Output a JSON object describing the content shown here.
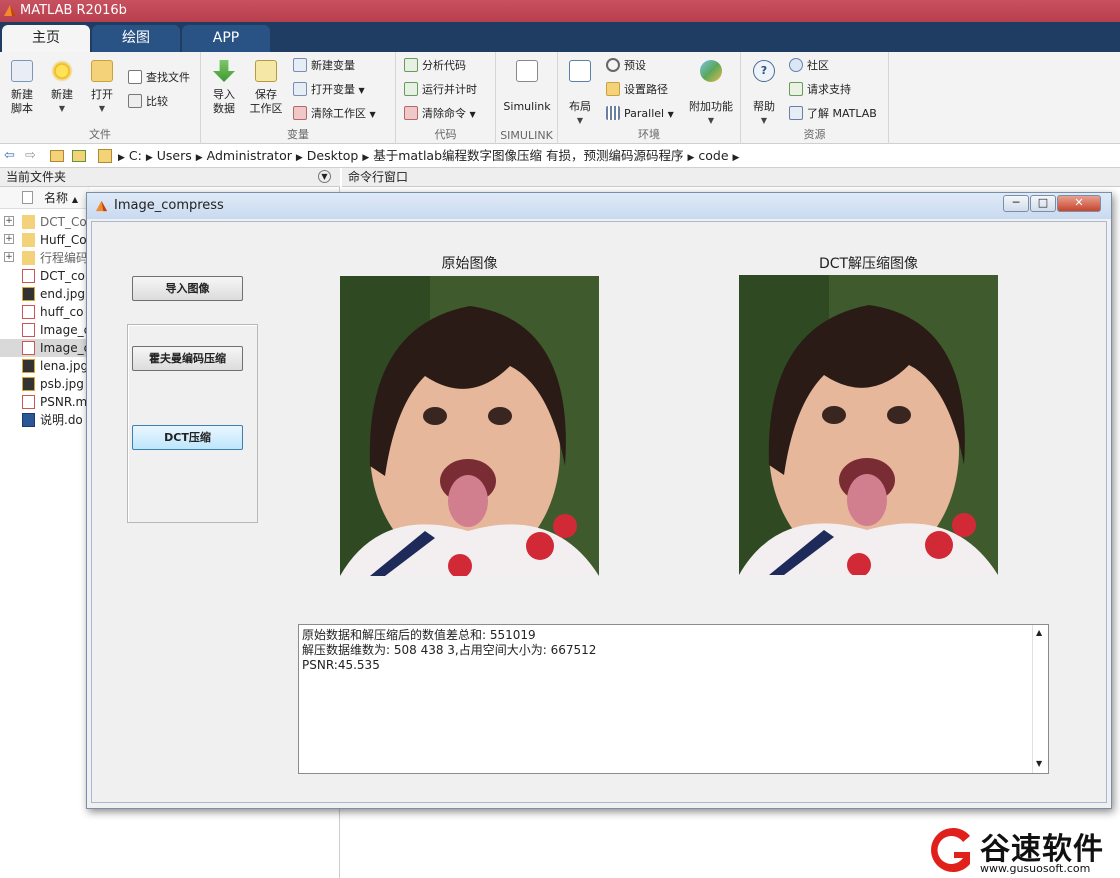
{
  "app": {
    "title": "MATLAB R2016b"
  },
  "tabs": [
    "主页",
    "绘图",
    "APP"
  ],
  "ribbon": {
    "file": {
      "label": "文件",
      "new_script": [
        "新建",
        "脚本"
      ],
      "new": "新建",
      "open": "打开",
      "find_files": "查找文件",
      "compare": "比较"
    },
    "variable": {
      "label": "变量",
      "import": [
        "导入",
        "数据"
      ],
      "save": [
        "保存",
        "工作区"
      ],
      "new_var": "新建变量",
      "open_var": "打开变量",
      "clear_ws": "清除工作区"
    },
    "code": {
      "label": "代码",
      "analyze": "分析代码",
      "run_time": "运行并计时",
      "clear_cmd": "清除命令"
    },
    "simulink": {
      "label": "SIMULINK",
      "btn": "Simulink"
    },
    "env": {
      "label": "环境",
      "layout": "布局",
      "prefs": "预设",
      "set_path": "设置路径",
      "parallel": "Parallel",
      "addons": "附加功能"
    },
    "res": {
      "label": "资源",
      "help": "帮助",
      "community": "社区",
      "support": "请求支持",
      "learn": "了解 MATLAB"
    }
  },
  "address": {
    "path": [
      "C:",
      "Users",
      "Administrator",
      "Desktop",
      "基于matlab编程数字图像压缩 有损，预测编码源码程序",
      "code"
    ]
  },
  "current_folder": {
    "title": "当前文件夹",
    "column": "名称",
    "items": [
      {
        "name": "DCT_Co",
        "type": "folder"
      },
      {
        "name": "Huff_Co",
        "type": "folder"
      },
      {
        "name": "行程编码",
        "type": "folder"
      },
      {
        "name": "DCT_co",
        "type": "m"
      },
      {
        "name": "end.jpg",
        "type": "jpg"
      },
      {
        "name": "huff_co",
        "type": "m"
      },
      {
        "name": "Image_c",
        "type": "m"
      },
      {
        "name": "Image_c",
        "type": "fig"
      },
      {
        "name": "lena.jpg",
        "type": "jpg"
      },
      {
        "name": "psb.jpg",
        "type": "jpg"
      },
      {
        "name": "PSNR.m",
        "type": "m"
      },
      {
        "name": "说明.do",
        "type": "doc"
      }
    ]
  },
  "command_window": {
    "title": "命令行窗口"
  },
  "figure": {
    "title": "Image_compress",
    "buttons": {
      "import": "导入图像",
      "huffman": "霍夫曼编码压缩",
      "dct": "DCT压缩"
    },
    "original_title": "原始图像",
    "decompressed_title": "DCT解压缩图像",
    "output_lines": [
      "原始数据和解压缩后的数值差总和: 551019",
      "解压数据维数为: 508   438     3,占用空间大小为:   667512",
      "PSNR:45.535"
    ]
  },
  "watermark": {
    "brand": "谷速软件",
    "url": "www.gusuosoft.com"
  },
  "colors": {
    "title_bar": "#c04a58",
    "tab_bar": "#1f3d63",
    "logo_red": "#e0201b"
  }
}
